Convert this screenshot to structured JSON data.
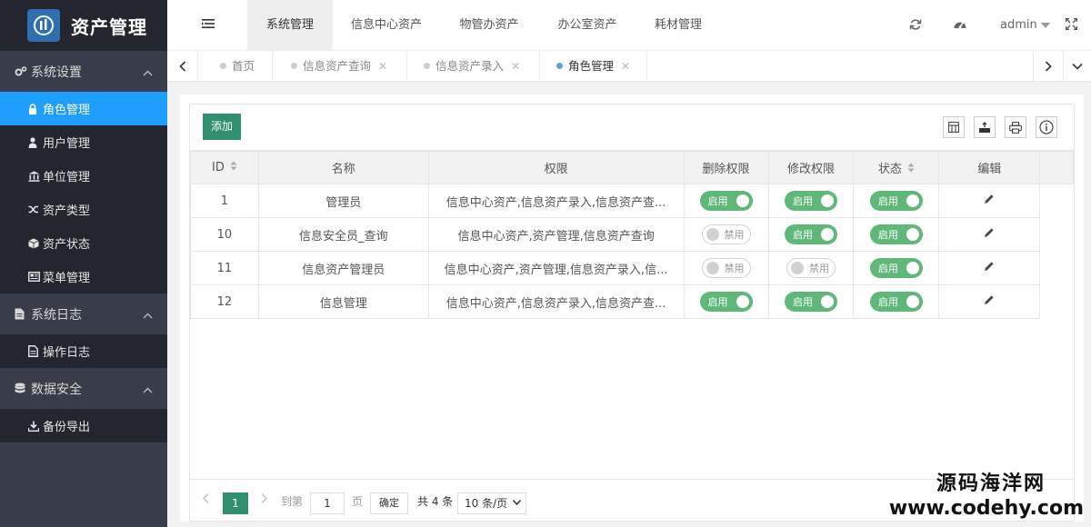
{
  "app": {
    "title": "资产管理"
  },
  "sidebar": {
    "groups": [
      {
        "label": "系统设置",
        "items": [
          "角色管理",
          "用户管理",
          "单位管理",
          "资产类型",
          "资产状态",
          "菜单管理"
        ]
      },
      {
        "label": "系统日志",
        "items": [
          "操作日志"
        ]
      },
      {
        "label": "数据安全",
        "items": [
          "备份导出"
        ]
      }
    ],
    "active_item": "角色管理"
  },
  "header": {
    "tabs": [
      "系统管理",
      "信息中心资产",
      "物管办资产",
      "办公室资产",
      "耗材管理"
    ],
    "active_tab": "系统管理",
    "user": "admin"
  },
  "tabstrip": {
    "tabs": [
      "首页",
      "信息资产查询",
      "信息资产录入",
      "角色管理"
    ],
    "active_tab": "角色管理"
  },
  "toolbar": {
    "add_label": "添加"
  },
  "table": {
    "columns": [
      "ID",
      "名称",
      "权限",
      "删除权限",
      "修改权限",
      "状态",
      "编辑"
    ],
    "rows": [
      {
        "id": "1",
        "name": "管理员",
        "perms": "信息中心资产,信息资产录入,信息资产查...",
        "delete": "启用",
        "modify": "启用",
        "status": "启用"
      },
      {
        "id": "10",
        "name": "信息安全员_查询",
        "perms": "信息中心资产,资产管理,信息资产查询",
        "delete": "禁用",
        "modify": "启用",
        "status": "启用"
      },
      {
        "id": "11",
        "name": "信息资产管理员",
        "perms": "信息中心资产,资产管理,信息资产录入,信...",
        "delete": "禁用",
        "modify": "禁用",
        "status": "启用"
      },
      {
        "id": "12",
        "name": "信息管理",
        "perms": "信息中心资产,信息资产录入,信息资产查...",
        "delete": "启用",
        "modify": "启用",
        "status": "启用"
      }
    ]
  },
  "pager": {
    "current": "1",
    "goto_label": "到第",
    "goto_value": "1",
    "page_unit": "页",
    "confirm": "确定",
    "total": "共 4 条",
    "page_size": "10 条/页"
  },
  "watermark": {
    "line1": "源码海洋网",
    "line2": "www.codehy.com"
  },
  "colors": {
    "sidebar": "#393d49",
    "sidebar_dark": "#23262e",
    "active": "#1e9fff",
    "switch_on": "#5fb878",
    "primary_btn": "#2f8f6f"
  }
}
